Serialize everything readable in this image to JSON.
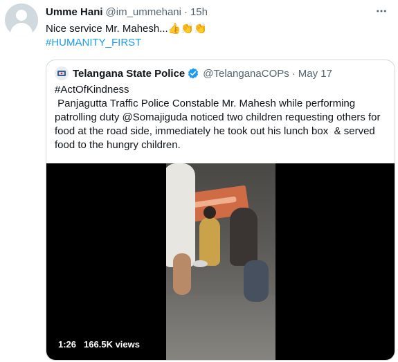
{
  "tweet": {
    "author_name": "Umme Hani",
    "author_handle": "@im_ummehani",
    "separator": "·",
    "time": "15h",
    "text": "Nice service Mr. Mahesh...",
    "emojis": "👍👏👏",
    "hashtag": "#HUMANITY_FIRST"
  },
  "quoted_tweet": {
    "author_name": "Telangana State Police",
    "author_handle": "@TelanganaCOPs",
    "separator": "·",
    "date": "May 17",
    "text_lines": [
      "#ActOfKindness",
      " Panjagutta Traffic Police Constable Mr. Mahesh while performing",
      "patrolling duty @Somajiguda noticed two children requesting others for",
      "food at the road side, immediately he took out his lunch box  & served",
      "food to the hungry children."
    ],
    "video": {
      "duration": "1:26",
      "views": "166.5K views"
    }
  },
  "icons": {
    "more": "more-horizontal-icon",
    "verified": "verified-badge-icon",
    "avatar": "default-avatar-icon",
    "quoted_avatar": "police-emblem-icon"
  },
  "colors": {
    "primary_text": "#0f1419",
    "secondary_text": "#536471",
    "link": "#1d9bf0",
    "border": "#cfd9de",
    "verified": "#1d9bf0"
  }
}
